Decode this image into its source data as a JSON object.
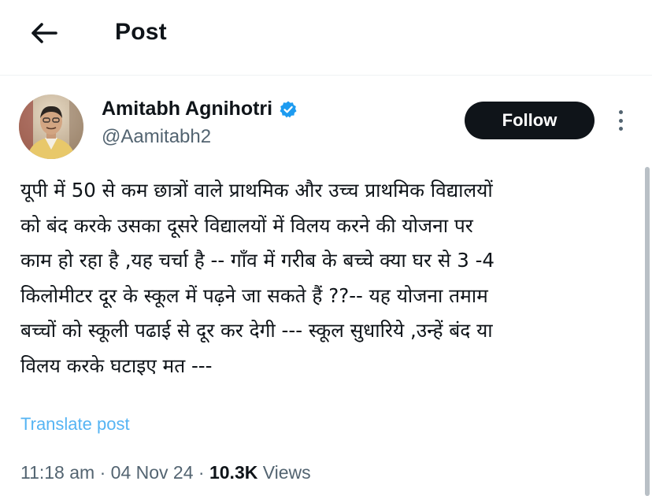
{
  "header": {
    "title": "Post",
    "back_icon": "arrow-left-icon"
  },
  "author": {
    "display_name": "Amitabh Agnihotri",
    "handle": "@Aamitabh2",
    "verified": true,
    "verified_color": "#1d9bf0"
  },
  "actions": {
    "follow_label": "Follow",
    "more_icon": "more-vertical-icon"
  },
  "post": {
    "lines": [
      "यूपी में 50 से कम छात्रों वाले प्राथमिक और उच्च प्राथमिक विद्यालयों",
      "को बंद करके उसका दूसरे विद्यालयों में विलय करने की योजना पर",
      "काम हो रहा है ,यह चर्चा है -- गाँव में गरीब के बच्चे क्या घर से 3 -4",
      "किलोमीटर दूर के स्कूल में पढ़ने जा सकते हैं ??-- यह योजना तमाम",
      "बच्चों को स्कूली पढाई से दूर कर देगी --- स्कूल सुधारिये ,उन्हें बंद या",
      "विलय करके घटाइए मत ---"
    ],
    "translate_label": "Translate post",
    "time": "11:18 am",
    "separator": "·",
    "date": "04 Nov 24",
    "views_count": "10.3K",
    "views_label": "Views"
  },
  "colors": {
    "text_primary": "#0f1419",
    "text_secondary": "#536471",
    "accent": "#1d9bf0",
    "follow_bg": "#0f1419"
  }
}
